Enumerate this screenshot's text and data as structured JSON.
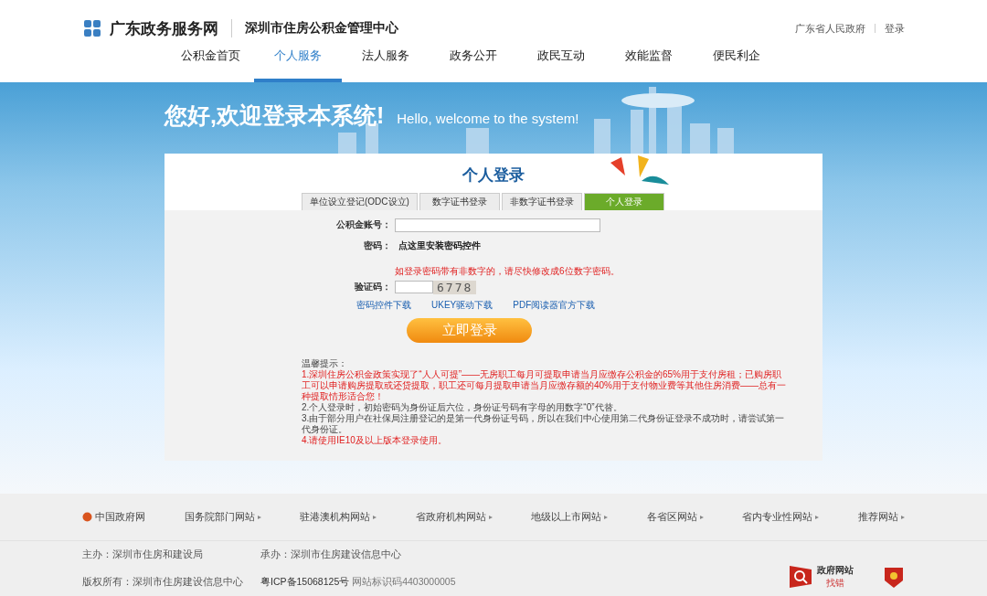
{
  "header": {
    "site_name": "广东政务服务网",
    "org_name": "深圳市住房公积金管理中心",
    "links": [
      "广东省人民政府",
      "登录"
    ]
  },
  "nav": [
    {
      "label": "公积金首页",
      "selected": false
    },
    {
      "label": "个人服务",
      "selected": true
    },
    {
      "label": "法人服务",
      "selected": false
    },
    {
      "label": "政务公开",
      "selected": false
    },
    {
      "label": "政民互动",
      "selected": false
    },
    {
      "label": "效能监督",
      "selected": false
    },
    {
      "label": "便民利企",
      "selected": false
    }
  ],
  "banner": {
    "greeting": "您好,欢迎登录本系统!",
    "greeting_en": "Hello, welcome to the system!"
  },
  "login": {
    "title": "个人登录",
    "tabs": [
      {
        "label": "单位设立登记(ODC设立)",
        "selected": false
      },
      {
        "label": "数字证书登录",
        "selected": false
      },
      {
        "label": "非数字证书登录",
        "selected": false
      },
      {
        "label": "个人登录",
        "selected": true
      }
    ],
    "account_label": "公积金账号：",
    "password_label": "密码：",
    "password_link": "点这里安装密码控件",
    "password_warning": "如登录密码带有非数字的，请尽快修改成6位数字密码。",
    "captcha_label": "验证码：",
    "captcha": "6778",
    "downloads": [
      "密码控件下载",
      "UKEY驱动下载",
      "PDF阅读器官方下载"
    ],
    "submit": "立即登录",
    "notice_title": "温馨提示：",
    "notices": [
      {
        "kind": "warning",
        "text": "1.深圳住房公积金政策实现了“人人可提”——无房职工每月可提取申请当月应缴存公积金的65%用于支付房租；已购房职工可以申请购房提取或还贷提取，职工还可每月提取申请当月应缴存额的40%用于支付物业费等其他住房消费——总有一种提取情形适合您！"
      },
      {
        "kind": "normal",
        "text": "2.个人登录时，初始密码为身份证后六位，身份证号码有字母的用数字“0”代替。"
      },
      {
        "kind": "normal",
        "text": "3.由于部分用户在社保局注册登记的是第一代身份证号码，所以在我们中心使用第二代身份证登录不成功时，请尝试第一代身份证。"
      },
      {
        "kind": "warning",
        "text": "4.请使用IE10及以上版本登录使用。"
      }
    ]
  },
  "footer": {
    "links": [
      "中国政府网",
      "国务院部门网站",
      "驻港澳机构网站",
      "省政府机构网站",
      "地级以上市网站",
      "各省区网站",
      "省内专业性网站",
      "推荐网站"
    ],
    "sponsor": "主办：深圳市住房和建设局",
    "operator": "承办：深圳市住房建设信息中心",
    "copyright": "版权所有：深圳市住房建设信息中心",
    "icp": "粤ICP备15068125号",
    "site_id": "网站标识码4403000005",
    "badge_title": "政府网站",
    "badge_sub": "找错"
  }
}
